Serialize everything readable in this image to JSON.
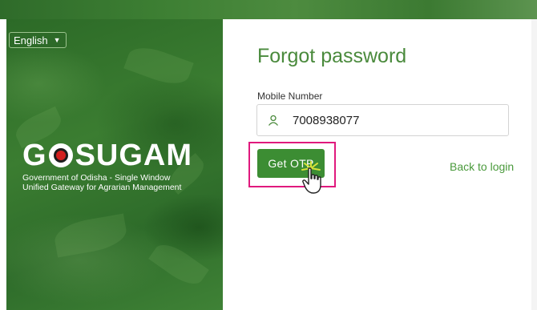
{
  "language_selector": {
    "value": "English",
    "chevron": "chevron-down-icon"
  },
  "branding": {
    "logo_word_left": "G",
    "logo_word_right": "SUGAM",
    "subtitle_line1": "Government of Odisha - Single Window",
    "subtitle_line2": "Unified Gateway for Agrarian Management"
  },
  "form": {
    "title": "Forgot password",
    "mobile_label": "Mobile Number",
    "mobile_icon": "user-icon",
    "mobile_value": "7008938077",
    "get_otp_label": "Get OTP",
    "back_to_login_label": "Back to login"
  },
  "colors": {
    "brand_green": "#3c8d33",
    "title_green": "#4a8a3c",
    "link_green": "#4a9a3c",
    "highlight_pink": "#e0197d"
  }
}
